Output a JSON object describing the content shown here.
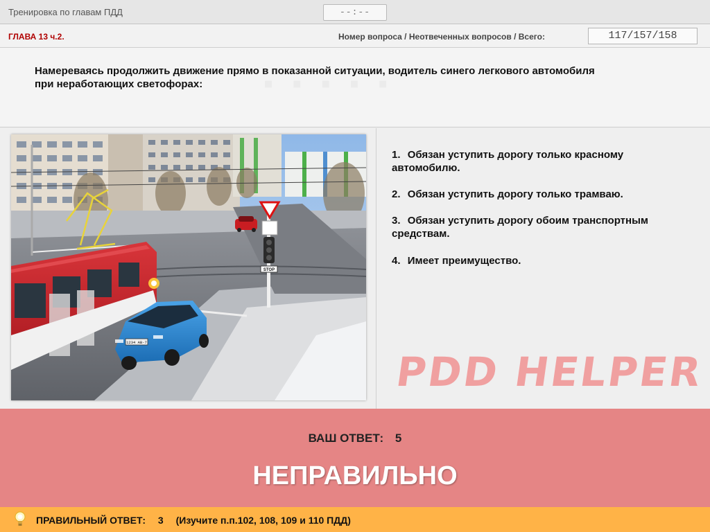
{
  "window": {
    "title": "Тренировка по главам ПДД",
    "timer": "--:--"
  },
  "info": {
    "chapter": "ГЛАВА 13 ч.2.",
    "counter_label": "Номер вопроса / Неотвеченных вопросов / Всего:",
    "counter_value": "117/157/158"
  },
  "question": {
    "text": "Намереваясь продолжить движение прямо в показанной ситуации, водитель синего легкового автомобиля при неработающих светофорах:"
  },
  "scene": {
    "sign_text": "STOP",
    "plate_text": "1234 AB-7"
  },
  "answers": [
    {
      "num": "1.",
      "text": "Обязан уступить дорогу только красному автомобилю."
    },
    {
      "num": "2.",
      "text": "Обязан уступить дорогу только трамваю."
    },
    {
      "num": "3.",
      "text": "Обязан уступить дорогу обоим транспортным средствам."
    },
    {
      "num": "4.",
      "text": "Имеет преимущество."
    }
  ],
  "watermark": "PDD HELPER",
  "result": {
    "your_answer_label": "ВАШ  ОТВЕТ:",
    "your_answer_value": "5",
    "verdict": "НЕПРАВИЛЬНО",
    "color": "#e58585"
  },
  "correct": {
    "icon": "lightbulb-icon",
    "label": "ПРАВИЛЬНЫЙ ОТВЕТ:",
    "value": "3",
    "note": "(Изучите п.п.102, 108, 109 и 110 ПДД)",
    "color": "#ffb347"
  }
}
